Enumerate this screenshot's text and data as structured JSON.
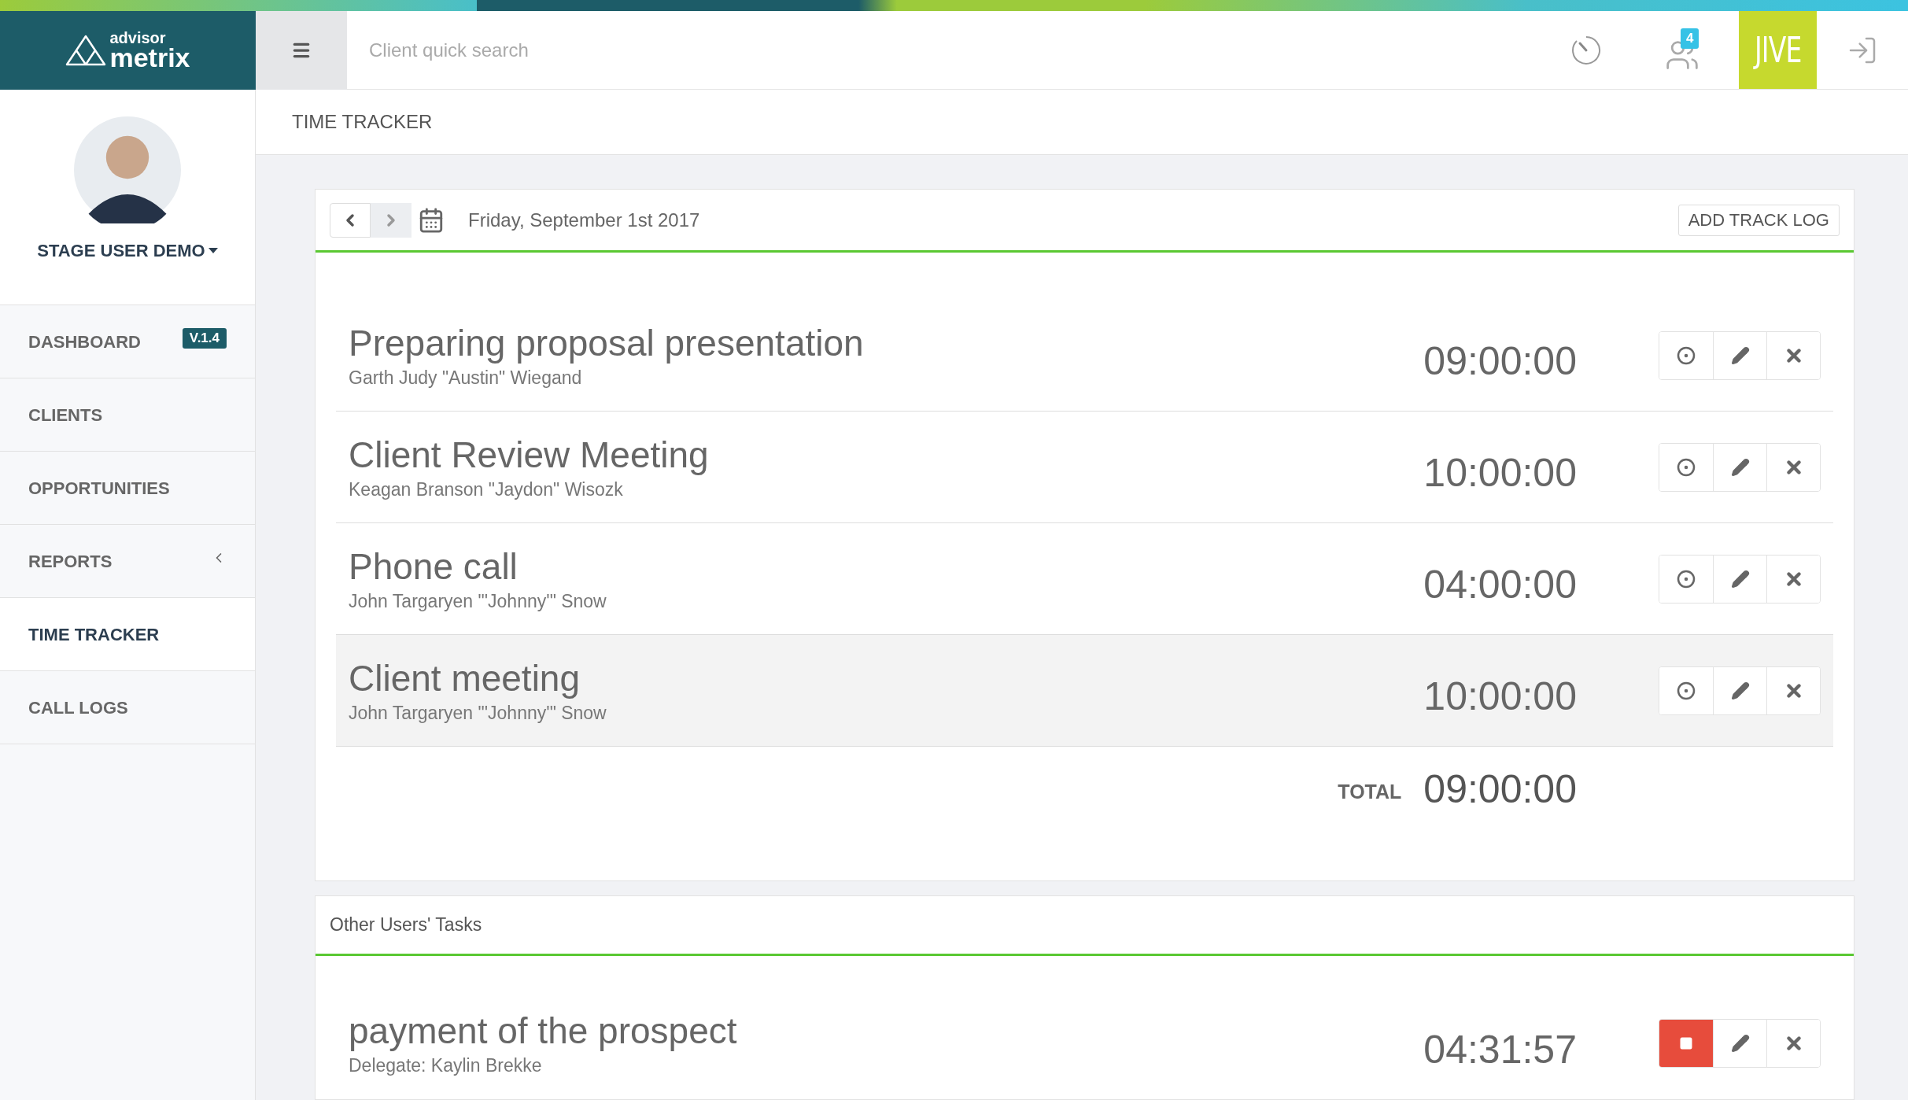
{
  "header": {
    "logo_small": "advisor",
    "logo_large": "metrix",
    "search": {
      "placeholder": "Client quick search"
    },
    "notification_count": "4",
    "jive_logo": "JIVE"
  },
  "sidebar": {
    "user_name": "STAGE USER DEMO",
    "items": [
      {
        "label": "DASHBOARD",
        "selected": false,
        "badge": "V.1.4",
        "has_submenu": false
      },
      {
        "label": "CLIENTS",
        "selected": false,
        "has_submenu": false
      },
      {
        "label": "OPPORTUNITIES",
        "selected": false,
        "has_submenu": false
      },
      {
        "label": "REPORTS",
        "selected": false,
        "has_submenu": true
      },
      {
        "label": "TIME TRACKER",
        "selected": true,
        "has_submenu": false
      },
      {
        "label": "CALL LOGS",
        "selected": false,
        "has_submenu": false
      }
    ]
  },
  "page_title": "TIME TRACKER",
  "tracker": {
    "date": "Friday, September 1st 2017",
    "add_button": "ADD TRACK LOG",
    "rows": [
      {
        "title": "Preparing proposal presentation",
        "client": "Garth Judy \"Austin\" Wiegand",
        "time": "09:00:00",
        "highlighted": false,
        "running": false
      },
      {
        "title": "Client Review Meeting",
        "client": "Keagan Branson \"Jaydon\" Wisozk",
        "time": "10:00:00",
        "highlighted": false,
        "running": false
      },
      {
        "title": "Phone call",
        "client": "John Targaryen \"'Johnny'\" Snow",
        "time": "04:00:00",
        "highlighted": false,
        "running": false
      },
      {
        "title": "Client meeting",
        "client": "John Targaryen \"'Johnny'\" Snow",
        "time": "10:00:00",
        "highlighted": true,
        "running": false
      }
    ],
    "total_label": "TOTAL",
    "total": "09:00:00"
  },
  "other_tasks": {
    "title": "Other Users' Tasks",
    "rows": [
      {
        "title": "payment of the prospect",
        "client": "Delegate: Kaylin Brekke",
        "time": "04:31:57",
        "highlighted": false,
        "running": true
      }
    ]
  }
}
